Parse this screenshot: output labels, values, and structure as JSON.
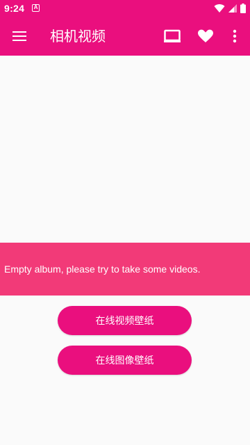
{
  "status_bar": {
    "time": "9:24",
    "notification_icon_label": "A",
    "icons": [
      "wifi-icon",
      "signal-icon",
      "battery-icon"
    ]
  },
  "app_bar": {
    "title": "相机视频",
    "icons": [
      "menu-icon",
      "cast-screen-icon",
      "heart-icon",
      "more-vert-icon"
    ]
  },
  "banner": {
    "message": "Empty album, please try to take some videos."
  },
  "buttons": {
    "online_video_wallpaper": "在线视频壁纸",
    "online_image_wallpaper": "在线图像壁纸"
  },
  "colors": {
    "primary": "#ea0f7e",
    "banner": "#f23a78",
    "background": "#fafafa"
  }
}
